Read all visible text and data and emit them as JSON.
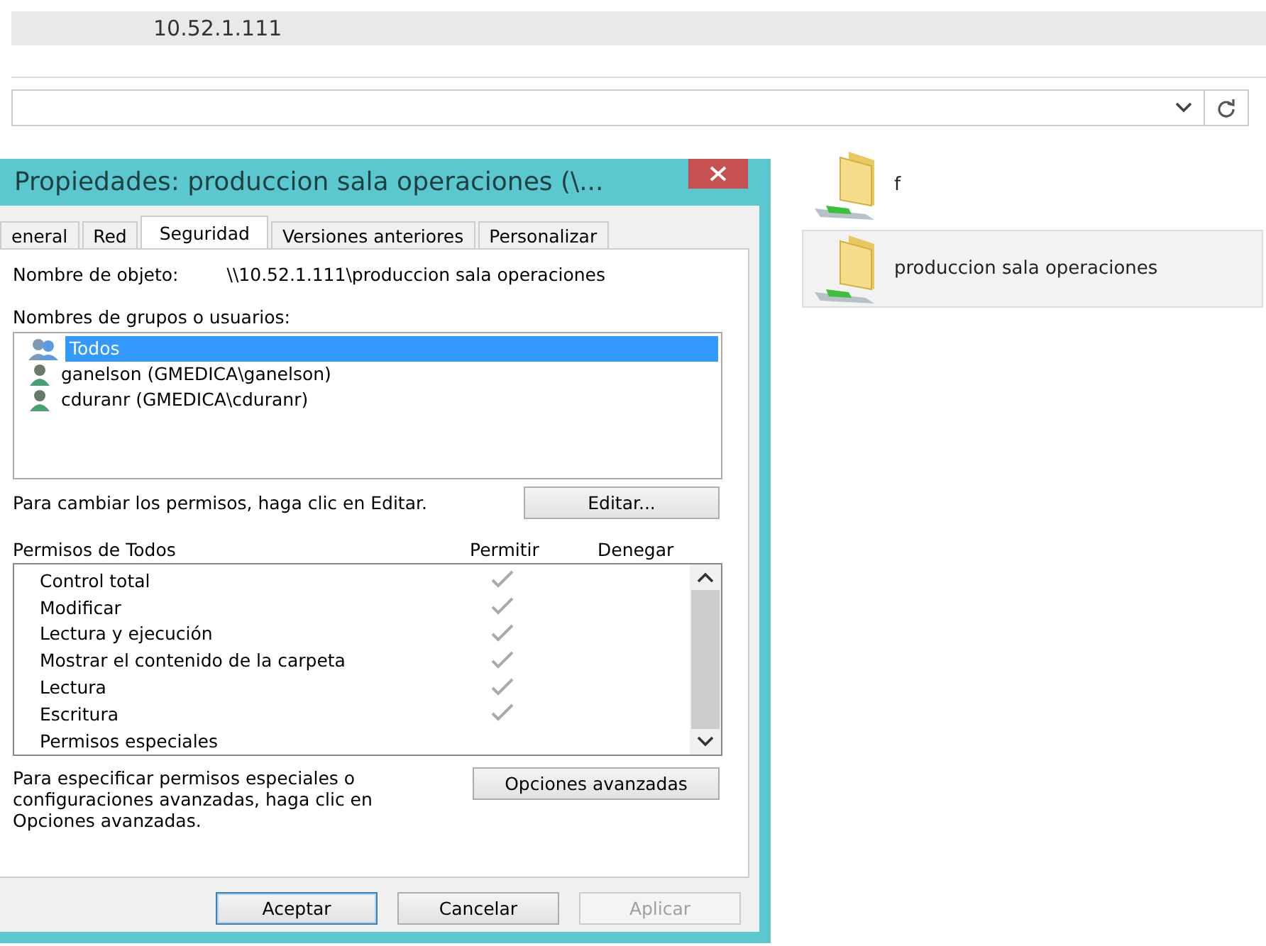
{
  "explorer": {
    "title": "10.52.1.111",
    "items": [
      {
        "name": "f",
        "selected": false
      },
      {
        "name": "produccion sala operaciones",
        "selected": true
      }
    ]
  },
  "dialog": {
    "title": "Propiedades: produccion sala operaciones (\\...",
    "tabs": [
      {
        "label": "eneral",
        "selected": false
      },
      {
        "label": "Red",
        "selected": false
      },
      {
        "label": "Seguridad",
        "selected": true
      },
      {
        "label": "Versiones anteriores",
        "selected": false
      },
      {
        "label": "Personalizar",
        "selected": false
      }
    ],
    "object_label": "Nombre de objeto:",
    "object_value": "\\\\10.52.1.111\\produccion sala operaciones",
    "users_label": "Nombres de grupos o usuarios:",
    "users": [
      {
        "name": "Todos",
        "kind": "group",
        "selected": true
      },
      {
        "name": "ganelson (GMEDICA\\ganelson)",
        "kind": "user",
        "selected": false
      },
      {
        "name": "cduranr (GMEDICA\\cduranr)",
        "kind": "user",
        "selected": false
      }
    ],
    "edit_hint": "Para cambiar los permisos, haga clic en Editar.",
    "edit_button": "Editar...",
    "permissions_label": "Permisos de Todos",
    "allow_header": "Permitir",
    "deny_header": "Denegar",
    "permissions": [
      {
        "name": "Control total",
        "allow": true
      },
      {
        "name": "Modificar",
        "allow": true
      },
      {
        "name": "Lectura y ejecución",
        "allow": true
      },
      {
        "name": "Mostrar el contenido de la carpeta",
        "allow": true
      },
      {
        "name": "Lectura",
        "allow": true
      },
      {
        "name": "Escritura",
        "allow": true
      },
      {
        "name": "Permisos especiales",
        "allow": false
      }
    ],
    "advanced_hint": "Para especificar permisos especiales o configuraciones avanzadas, haga clic en Opciones avanzadas.",
    "advanced_button": "Opciones avanzadas",
    "buttons": [
      {
        "label": "Aceptar",
        "kind": "default"
      },
      {
        "label": "Cancelar",
        "kind": "normal"
      },
      {
        "label": "Aplicar",
        "kind": "disabled"
      }
    ]
  }
}
